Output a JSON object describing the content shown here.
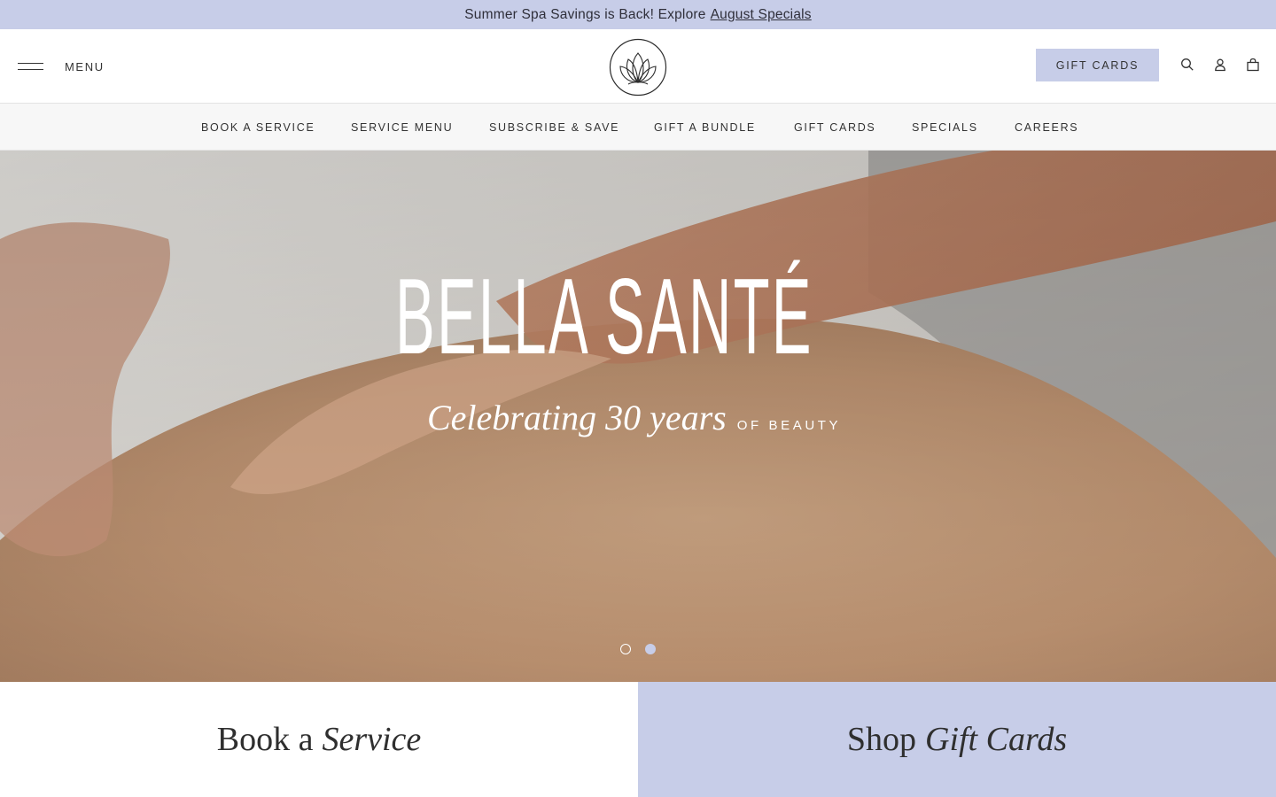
{
  "announcement": {
    "text": "Summer Spa Savings is Back! Explore",
    "link": "August Specials"
  },
  "header": {
    "menu_label": "MENU",
    "logo_icon": "lotus-logo-icon",
    "gift_cards_button": "GIFT CARDS",
    "icons": [
      "search-icon",
      "account-icon",
      "cart-icon"
    ]
  },
  "nav": {
    "items": [
      {
        "label": "BOOK A SERVICE"
      },
      {
        "label": "SERVICE MENU"
      },
      {
        "label": "SUBSCRIBE & SAVE"
      },
      {
        "label": "GIFT A BUNDLE"
      },
      {
        "label": "GIFT CARDS"
      },
      {
        "label": "SPECIALS"
      },
      {
        "label": "CAREERS"
      }
    ]
  },
  "hero": {
    "brand": "BELLA SANTÉ",
    "tagline_script": "Celebrating 30 years",
    "tagline_small": "OF BEAUTY",
    "slide_count": 2,
    "active_slide": 2
  },
  "cards": {
    "left": {
      "plain": "Book a",
      "italic": "Service"
    },
    "right": {
      "plain": "Shop",
      "italic": "Gift Cards"
    }
  },
  "colors": {
    "accent": "#c7cde8",
    "text": "#2f2f2f",
    "nav_bg": "#f7f7f7"
  }
}
